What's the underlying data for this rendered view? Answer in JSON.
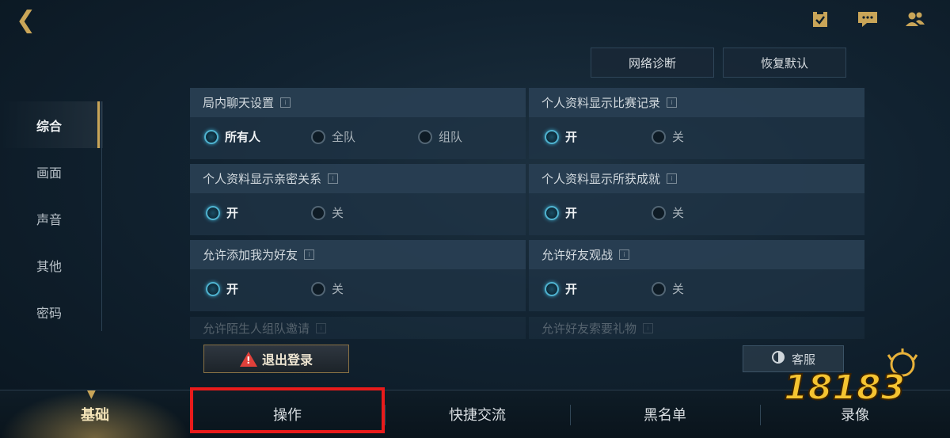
{
  "header": {
    "back_icon": "back-arrow-icon",
    "icons": [
      "clipboard-icon",
      "chat-icon",
      "friends-icon"
    ],
    "network_diagnosis": "网络诊断",
    "restore_default": "恢复默认"
  },
  "sidebar": {
    "items": [
      {
        "label": "综合",
        "active": true
      },
      {
        "label": "画面",
        "active": false
      },
      {
        "label": "声音",
        "active": false
      },
      {
        "label": "其他",
        "active": false
      },
      {
        "label": "密码",
        "active": false
      }
    ]
  },
  "settings": [
    {
      "title": "局内聊天设置",
      "options": [
        "所有人",
        "全队",
        "组队"
      ],
      "selected": 0
    },
    {
      "title": "个人资料显示比赛记录",
      "options": [
        "开",
        "关"
      ],
      "selected": 0
    },
    {
      "title": "个人资料显示亲密关系",
      "options": [
        "开",
        "关"
      ],
      "selected": 0
    },
    {
      "title": "个人资料显示所获成就",
      "options": [
        "开",
        "关"
      ],
      "selected": 0
    },
    {
      "title": "允许添加我为好友",
      "options": [
        "开",
        "关"
      ],
      "selected": 0
    },
    {
      "title": "允许好友观战",
      "options": [
        "开",
        "关"
      ],
      "selected": 0
    },
    {
      "title": "允许陌生人组队邀请",
      "options": [],
      "selected": null
    },
    {
      "title": "允许好友索要礼物",
      "options": [],
      "selected": null
    }
  ],
  "actions": {
    "logout": "退出登录",
    "service": "客服"
  },
  "tabs": [
    {
      "label": "基础",
      "active": true
    },
    {
      "label": "操作",
      "active": false
    },
    {
      "label": "快捷交流",
      "active": false
    },
    {
      "label": "黑名单",
      "active": false
    },
    {
      "label": "录像",
      "active": false
    }
  ],
  "watermark": "18183",
  "colors": {
    "accent": "#c9a558",
    "highlight": "#e81b1b",
    "radio_on": "#4fb3d0"
  }
}
